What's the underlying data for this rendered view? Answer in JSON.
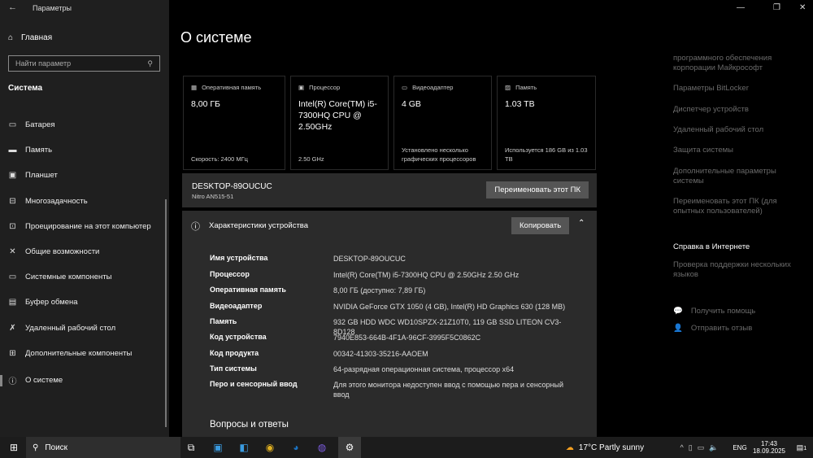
{
  "window": {
    "title": "Параметры",
    "back_icon": "←",
    "minimize": "—",
    "maximize": "❐",
    "close": "✕"
  },
  "sidebar": {
    "home": "Главная",
    "search_placeholder": "Найти параметр",
    "section": "Система",
    "items": [
      {
        "label": "Батарея",
        "icon": "▭"
      },
      {
        "label": "Память",
        "icon": "▬"
      },
      {
        "label": "Планшет",
        "icon": "▣"
      },
      {
        "label": "Многозадачность",
        "icon": "⊟"
      },
      {
        "label": "Проецирование на этот компьютер",
        "icon": "⊡"
      },
      {
        "label": "Общие возможности",
        "icon": "✕"
      },
      {
        "label": "Системные компоненты",
        "icon": "▭"
      },
      {
        "label": "Буфер обмена",
        "icon": "▤"
      },
      {
        "label": "Удаленный рабочий стол",
        "icon": "✗"
      },
      {
        "label": "Дополнительные компоненты",
        "icon": "⊞"
      },
      {
        "label": "О системе",
        "icon": "ⓘ"
      }
    ]
  },
  "main": {
    "title": "О системе",
    "cards": [
      {
        "icon": "▦",
        "label": "Оперативная память",
        "value": "8,00 ГБ",
        "footer": "Скорость: 2400 МГц"
      },
      {
        "icon": "▣",
        "label": "Процессор",
        "value": "Intel(R) Core(TM) i5-7300HQ CPU @ 2.50GHz",
        "footer": "2.50 GHz"
      },
      {
        "icon": "▭",
        "label": "Видеоадаптер",
        "value": "4 GB",
        "footer": "Установлено несколько графических процессоров"
      },
      {
        "icon": "▨",
        "label": "Память",
        "value": "1.03 TB",
        "footer": "Используется 186 GB из 1.03 TB"
      }
    ],
    "device": {
      "name": "DESKTOP-89OUCUC",
      "model": "Nitro AN515-51",
      "rename": "Переименовать этот ПК"
    },
    "specs": {
      "title": "Характеристики устройства",
      "copy": "Копировать",
      "rows": [
        {
          "k": "Имя устройства",
          "v": "DESKTOP-89OUCUC"
        },
        {
          "k": "Процессор",
          "v": "Intel(R) Core(TM) i5-7300HQ CPU @ 2.50GHz   2.50 GHz"
        },
        {
          "k": "Оперативная память",
          "v": "8,00 ГБ (доступно: 7,89 ГБ)"
        },
        {
          "k": "Видеоадаптер",
          "v": "NVIDIA GeForce GTX 1050 (4 GB), Intel(R) HD Graphics 630 (128 MB)"
        },
        {
          "k": "Память",
          "v": "932 GB HDD WDC WD10SPZX-21Z10T0, 119 GB SSD LITEON CV3-8D128"
        },
        {
          "k": "Код устройства",
          "v": "7940E853-664B-4F1A-96CF-3995F5C0862C"
        },
        {
          "k": "Код продукта",
          "v": "00342-41303-35216-AAOEM"
        },
        {
          "k": "Тип системы",
          "v": "64-разрядная операционная система, процессор x64"
        },
        {
          "k": "Перо и сенсорный ввод",
          "v": "Для этого монитора недоступен ввод с помощью пера и сенсорный ввод"
        }
      ]
    },
    "faq": "Вопросы и ответы"
  },
  "related": {
    "links": [
      "программного обеспечения корпорации Майкрософт",
      "Параметры BitLocker",
      "Диспетчер устройств",
      "Удаленный рабочий стол",
      "Защита системы",
      "Дополнительные параметры системы",
      "Переименовать этот ПК (для опытных пользователей)"
    ],
    "help_heading": "Справка в Интернете",
    "help_link": "Проверка поддержки нескольких языков",
    "get_help": "Получить помощь",
    "feedback": "Отправить отзыв"
  },
  "taskbar": {
    "search": "Поиск",
    "weather": "17°C  Partly sunny",
    "lang": "ENG",
    "time": "17:43",
    "date": "18.09.2025",
    "notif": "1"
  }
}
